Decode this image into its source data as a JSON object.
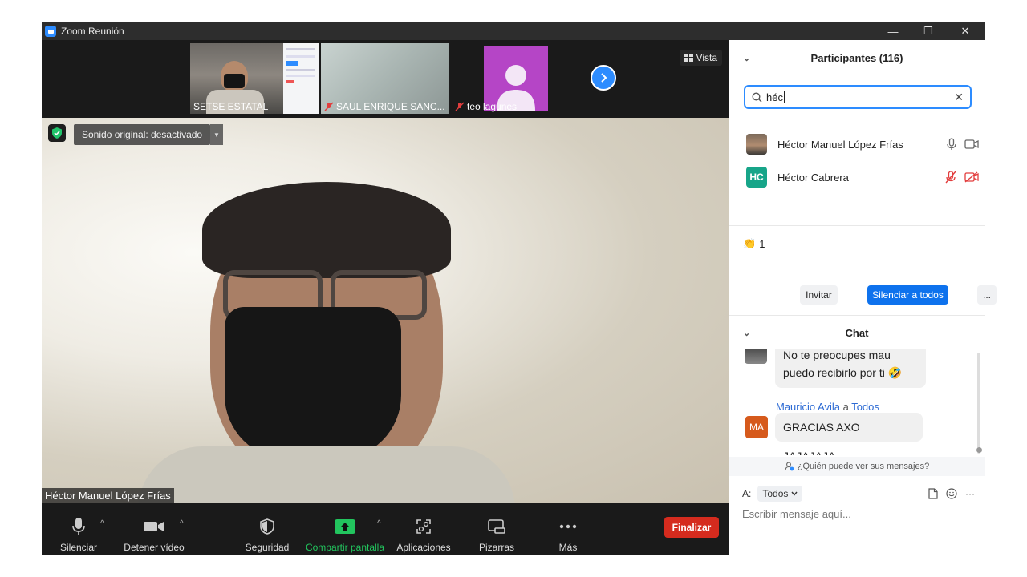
{
  "window": {
    "title": "Zoom Reunión",
    "minimize_glyph": "—",
    "restore_glyph": "❐",
    "close_glyph": "✕"
  },
  "thumbnails": [
    {
      "name": "SETSE ESTATAL",
      "muted": false
    },
    {
      "name": "SAUL ENRIQUE SANC...",
      "muted": true
    },
    {
      "name": "teo lagunes",
      "muted": true
    }
  ],
  "view_button": "Vista",
  "main_video": {
    "audio_pill": "Sonido original: desactivado",
    "speaker_name": "Héctor Manuel López Frías"
  },
  "toolbar": {
    "mute": "Silenciar",
    "stop_video": "Detener vídeo",
    "security": "Seguridad",
    "share": "Compartir pantalla",
    "apps": "Aplicaciones",
    "whiteboards": "Pizarras",
    "more": "Más",
    "end": "Finalizar",
    "share_color": "#22c55e",
    "end_color": "#d52b1e"
  },
  "participants": {
    "header": "Participantes (116)",
    "search_value": "héc",
    "list": [
      {
        "name": "Héctor Manuel López Frías",
        "initials": "",
        "audio": "on",
        "video": "on"
      },
      {
        "name": "Héctor Cabrera",
        "initials": "HC",
        "audio": "muted",
        "video": "off"
      }
    ],
    "reaction_emoji": "👏",
    "reaction_count": "1",
    "invite": "Invitar",
    "mute_all": "Silenciar a todos",
    "more": "..."
  },
  "chat": {
    "header": "Chat",
    "messages": [
      {
        "line1": "No te preocupes mau",
        "line2": "puedo recibirlo por ti 🤣"
      },
      {
        "sender": "Mauricio Avila",
        "to_word": " a ",
        "recipient": "Todos",
        "initials": "MA",
        "text": "GRACIAS  AXO JAJAJAJA"
      }
    ],
    "who_can_see": "¿Quién puede ver sus mensajes?",
    "to_label": "A:",
    "to_value": "Todos",
    "placeholder": "Escribir mensaje aquí...",
    "more_glyph": "···"
  }
}
